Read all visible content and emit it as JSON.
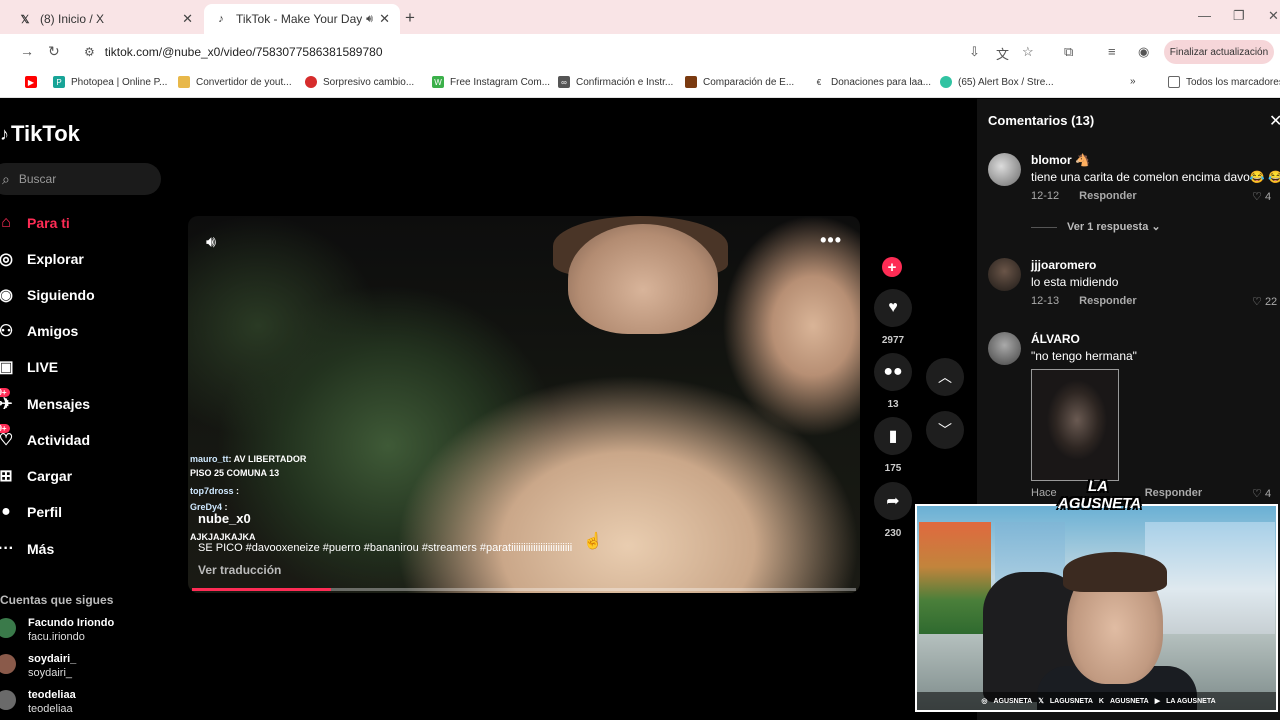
{
  "browser": {
    "tabs": [
      {
        "title": "(8) Inicio / X",
        "favicon": "x-logo-icon",
        "active": false
      },
      {
        "title": "TikTok - Make Your Day",
        "favicon": "tiktok-logo-icon",
        "active": true
      }
    ],
    "url": "tiktok.com/@nube_x0/video/7583077586381589780",
    "update_button": "Finalizar actualización",
    "bookmarks": [
      {
        "label": "",
        "icon": "youtube-icon",
        "color": "#ff0000"
      },
      {
        "label": "Photopea | Online P...",
        "icon": "photopea-icon",
        "color": "#18a497"
      },
      {
        "label": "Convertidor de yout...",
        "icon": "folder-icon",
        "color": "#e8b84a"
      },
      {
        "label": "Sorpresivo cambio...",
        "icon": "news-icon",
        "color": "#d62c2c"
      },
      {
        "label": "Free Instagram Com...",
        "icon": "w-icon",
        "color": "#3bb04a"
      },
      {
        "label": "Confirmación e Instr...",
        "icon": "link-icon",
        "color": "#555555"
      },
      {
        "label": "Comparación de E...",
        "icon": "compare-icon",
        "color": "#7a3a10"
      },
      {
        "label": "Donaciones para laa...",
        "icon": "donation-icon",
        "color": "#333333"
      },
      {
        "label": "(65) Alert Box / Stre...",
        "icon": "streamlabs-icon",
        "color": "#31c3a2"
      }
    ],
    "all_bookmarks": "Todos los marcadores"
  },
  "tiktok": {
    "logo": "TikTok",
    "search_placeholder": "Buscar",
    "nav": [
      {
        "label": "Para ti",
        "icon": "home-icon",
        "glyph": "⌂",
        "badge": ""
      },
      {
        "label": "Explorar",
        "icon": "compass-icon",
        "glyph": "◎",
        "badge": ""
      },
      {
        "label": "Siguiendo",
        "icon": "following-avatar-icon",
        "glyph": "◉",
        "badge": ""
      },
      {
        "label": "Amigos",
        "icon": "friends-icon",
        "glyph": "⚇",
        "badge": ""
      },
      {
        "label": "LIVE",
        "icon": "live-icon",
        "glyph": "▣",
        "badge": ""
      },
      {
        "label": "Mensajes",
        "icon": "messages-icon",
        "glyph": "✈",
        "badge": "99+"
      },
      {
        "label": "Actividad",
        "icon": "activity-icon",
        "glyph": "♡",
        "badge": "99+"
      },
      {
        "label": "Cargar",
        "icon": "upload-icon",
        "glyph": "⊞",
        "badge": ""
      },
      {
        "label": "Perfil",
        "icon": "profile-icon",
        "glyph": "●",
        "badge": ""
      },
      {
        "label": "Más",
        "icon": "more-icon",
        "glyph": "···",
        "badge": ""
      }
    ],
    "following_title": "Cuentas que sigues",
    "following": [
      {
        "name": "Facundo Iriondo",
        "username": "facu.iriondo",
        "color": "#3a7a4a"
      },
      {
        "name": "soydairi_",
        "username": "soydairi_",
        "color": "#8a5a4a"
      },
      {
        "name": "teodeliaa",
        "username": "teodeliaa",
        "color": "#6a6a6a"
      }
    ]
  },
  "video": {
    "chat": [
      {
        "user": "mauro_tt",
        "text": ": AV LIBERTADOR"
      },
      {
        "user": "",
        "text": "PISO 25 COMUNA 13"
      },
      {
        "user": "top7dross",
        "text": " :"
      },
      {
        "user": "GreDy4",
        "text": " :"
      },
      {
        "user": "",
        "text": "AJKJAJKAJKA"
      }
    ],
    "author": "nube_x0",
    "description": "SE PICO #davooxeneize #puerro #bananirou #streamers #paratiiiiiiiiiiiiiiiiiiiiiiiii",
    "translate": "Ver traducción",
    "progress": 0.21,
    "likes": "2977",
    "comments": "13",
    "saves": "175",
    "shares": "230"
  },
  "comments_panel": {
    "title": "Comentarios (13)",
    "items": [
      {
        "user": "blomor",
        "user_suffix": "🐴",
        "text": "tiene una carita de comelon encima davo😂 😂",
        "date": "12-12",
        "reply": "Responder",
        "likes": "4",
        "avatar_color": "#9a9a9a"
      },
      {
        "user": "jjjoaromero",
        "user_suffix": "",
        "text": "lo esta midiendo",
        "date": "12-13",
        "reply": "Responder",
        "likes": "22",
        "avatar_color": "#4a3a30"
      },
      {
        "user": "ÁLVARO",
        "user_suffix": "",
        "text": "\"no tengo hermana\"",
        "date": "Hace",
        "reply": "Responder",
        "likes": "4",
        "avatar_color": "#777777"
      }
    ],
    "view_replies": "Ver 1 respuesta"
  },
  "webcam": {
    "logo": "LA AGUSNETA",
    "socials": [
      "AGUSNETA",
      "LAGUSNETA",
      "AGUSNETA",
      "LA AGUSNETA"
    ]
  }
}
